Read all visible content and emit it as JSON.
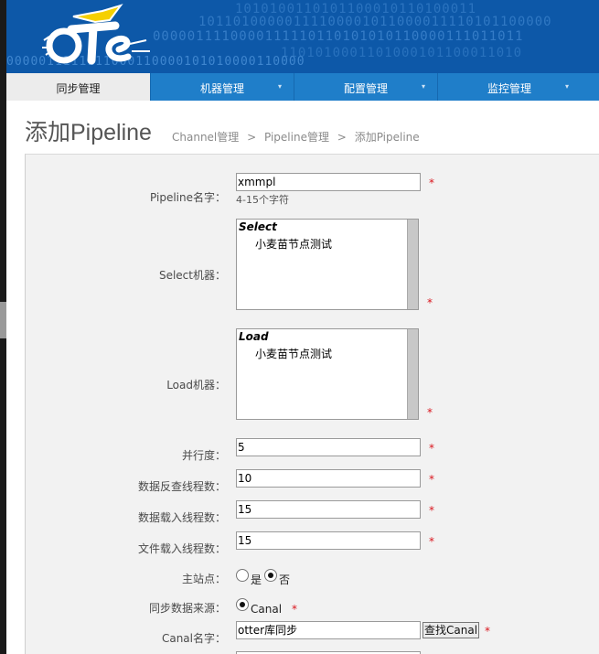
{
  "header": {
    "binary_rows": [
      "1010100110101100010110100011",
      "10110100000111100001011000011110101100000",
      "0000011110000111110110101010110000111011011",
      "0000011111111000110000101010000110000",
      "1101010001101000101100011010"
    ]
  },
  "nav": {
    "tabs": [
      {
        "label": "同步管理",
        "active": true,
        "has_dropdown": false
      },
      {
        "label": "机器管理",
        "active": false,
        "has_dropdown": true
      },
      {
        "label": "配置管理",
        "active": false,
        "has_dropdown": true
      },
      {
        "label": "监控管理",
        "active": false,
        "has_dropdown": true
      }
    ],
    "dropdown_arrow": "▾"
  },
  "page": {
    "title": "添加Pipeline",
    "breadcrumb": [
      "Channel管理",
      "Pipeline管理",
      "添加Pipeline"
    ],
    "breadcrumb_sep": ">"
  },
  "form": {
    "required_mark": "*",
    "pipeline_name": {
      "label": "Pipeline名字：",
      "value": "xmmpl",
      "hint": "4-15个字符"
    },
    "select_machines": {
      "label": "Select机器：",
      "group": "Select",
      "options": [
        "小麦苗节点测试"
      ]
    },
    "load_machines": {
      "label": "Load机器：",
      "group": "Load",
      "options": [
        "小麦苗节点测试"
      ]
    },
    "parallelism": {
      "label": "并行度：",
      "value": "5"
    },
    "extract_threads": {
      "label": "数据反查线程数：",
      "value": "10"
    },
    "load_threads": {
      "label": "数据载入线程数：",
      "value": "15"
    },
    "file_load_threads": {
      "label": "文件载入线程数：",
      "value": "15"
    },
    "home_station": {
      "label": "主站点：",
      "options": [
        {
          "label": "是",
          "selected": false
        },
        {
          "label": "否",
          "selected": true
        }
      ]
    },
    "sync_source": {
      "label": "同步数据来源：",
      "options": [
        {
          "label": "Canal",
          "selected": true
        }
      ]
    },
    "canal_name": {
      "label": "Canal名字：",
      "value": "otter库同步",
      "button_label": "查找Canal"
    }
  },
  "colors": {
    "header_blue": "#0d58a8",
    "nav_blue": "#1f7ec9",
    "required_red": "#d9141c",
    "logo_yellow": "#f5d000"
  }
}
